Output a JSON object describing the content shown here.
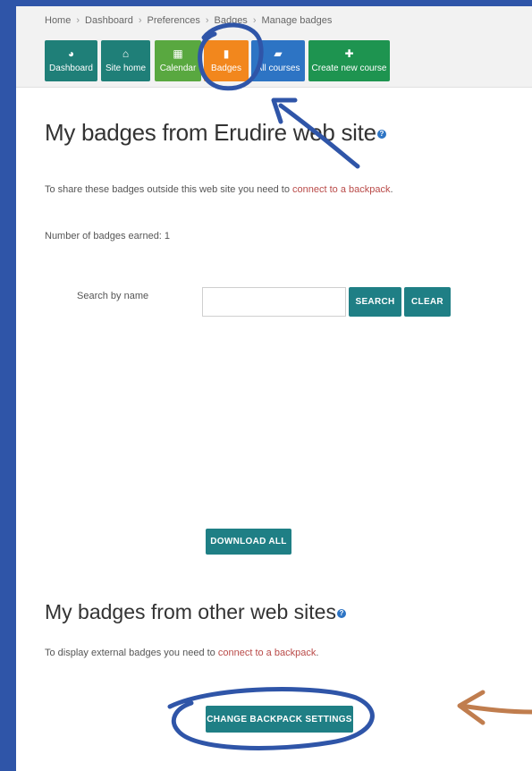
{
  "breadcrumb": {
    "items": [
      "Home",
      "Dashboard",
      "Preferences",
      "Badges",
      "Manage badges"
    ],
    "separator": "›"
  },
  "nav": {
    "buttons": [
      {
        "label": "Dashboard",
        "icon": "dashboard-icon",
        "glyph": "◕",
        "color": "#1f7f78"
      },
      {
        "label": "Site home",
        "icon": "home-icon",
        "glyph": "⌂",
        "color": "#1f7f78"
      },
      {
        "label": "Calendar",
        "icon": "calendar-icon",
        "glyph": "▦",
        "color": "#59a840"
      },
      {
        "label": "Badges",
        "icon": "bookmark-icon",
        "glyph": "▮",
        "color": "#f2871d"
      },
      {
        "label": "All courses",
        "icon": "book-icon",
        "glyph": "▰",
        "color": "#2d74c4"
      },
      {
        "label": "Create new course",
        "icon": "plus-icon",
        "glyph": "✚",
        "color": "#1e9450"
      }
    ]
  },
  "main": {
    "title": "My badges from Erudire web site",
    "share_text_prefix": "To share these badges outside this web site you need to ",
    "share_link": "connect to a backpack",
    "share_text_suffix": ".",
    "earned": "Number of badges earned: 1",
    "search": {
      "label": "Search by name",
      "value": "",
      "placeholder": "",
      "search_button": "SEARCH",
      "clear_button": "CLEAR"
    },
    "download_button": "DOWNLOAD ALL"
  },
  "external": {
    "title": "My badges from other web sites",
    "text_prefix": "To display external badges you need to ",
    "link": "connect to a backpack",
    "text_suffix": ".",
    "button": "CHANGE BACKPACK SETTINGS"
  },
  "help_glyph": "?",
  "colors": {
    "frame": "#2f55a8",
    "teal_button": "#1f7f85",
    "link": "#b94a48",
    "annotation_blue": "#2f55a8",
    "annotation_brown": "#c07d4e"
  }
}
